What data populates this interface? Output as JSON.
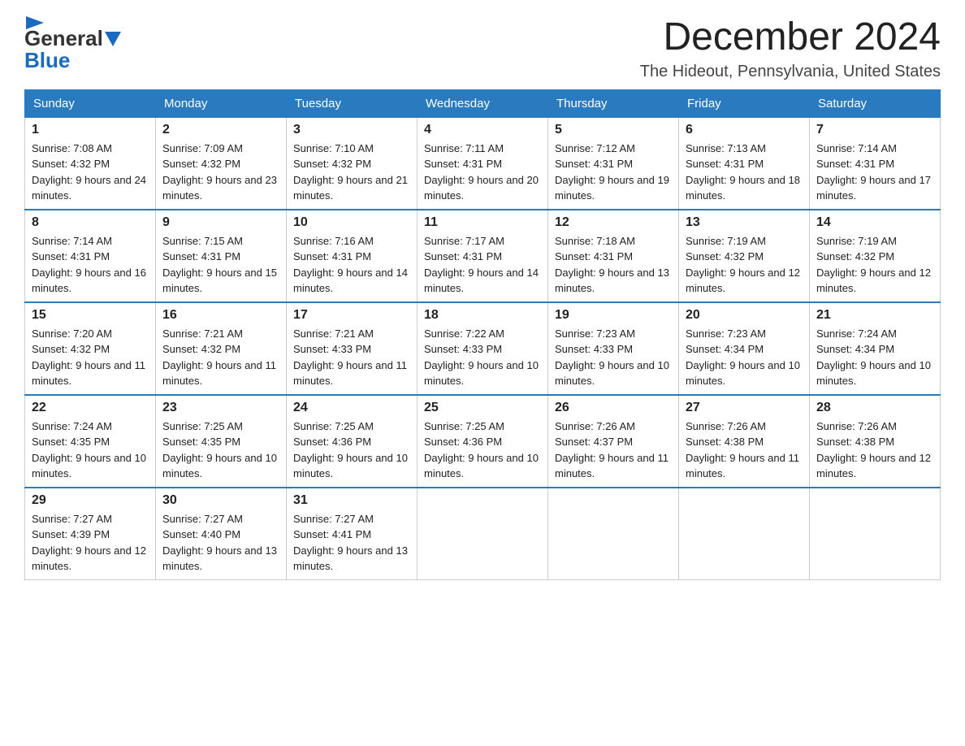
{
  "logo": {
    "general": "General",
    "blue": "Blue"
  },
  "title": {
    "month": "December 2024",
    "location": "The Hideout, Pennsylvania, United States"
  },
  "header": {
    "days": [
      "Sunday",
      "Monday",
      "Tuesday",
      "Wednesday",
      "Thursday",
      "Friday",
      "Saturday"
    ]
  },
  "weeks": [
    [
      {
        "date": "1",
        "sunrise": "7:08 AM",
        "sunset": "4:32 PM",
        "daylight": "9 hours and 24 minutes."
      },
      {
        "date": "2",
        "sunrise": "7:09 AM",
        "sunset": "4:32 PM",
        "daylight": "9 hours and 23 minutes."
      },
      {
        "date": "3",
        "sunrise": "7:10 AM",
        "sunset": "4:32 PM",
        "daylight": "9 hours and 21 minutes."
      },
      {
        "date": "4",
        "sunrise": "7:11 AM",
        "sunset": "4:31 PM",
        "daylight": "9 hours and 20 minutes."
      },
      {
        "date": "5",
        "sunrise": "7:12 AM",
        "sunset": "4:31 PM",
        "daylight": "9 hours and 19 minutes."
      },
      {
        "date": "6",
        "sunrise": "7:13 AM",
        "sunset": "4:31 PM",
        "daylight": "9 hours and 18 minutes."
      },
      {
        "date": "7",
        "sunrise": "7:14 AM",
        "sunset": "4:31 PM",
        "daylight": "9 hours and 17 minutes."
      }
    ],
    [
      {
        "date": "8",
        "sunrise": "7:14 AM",
        "sunset": "4:31 PM",
        "daylight": "9 hours and 16 minutes."
      },
      {
        "date": "9",
        "sunrise": "7:15 AM",
        "sunset": "4:31 PM",
        "daylight": "9 hours and 15 minutes."
      },
      {
        "date": "10",
        "sunrise": "7:16 AM",
        "sunset": "4:31 PM",
        "daylight": "9 hours and 14 minutes."
      },
      {
        "date": "11",
        "sunrise": "7:17 AM",
        "sunset": "4:31 PM",
        "daylight": "9 hours and 14 minutes."
      },
      {
        "date": "12",
        "sunrise": "7:18 AM",
        "sunset": "4:31 PM",
        "daylight": "9 hours and 13 minutes."
      },
      {
        "date": "13",
        "sunrise": "7:19 AM",
        "sunset": "4:32 PM",
        "daylight": "9 hours and 12 minutes."
      },
      {
        "date": "14",
        "sunrise": "7:19 AM",
        "sunset": "4:32 PM",
        "daylight": "9 hours and 12 minutes."
      }
    ],
    [
      {
        "date": "15",
        "sunrise": "7:20 AM",
        "sunset": "4:32 PM",
        "daylight": "9 hours and 11 minutes."
      },
      {
        "date": "16",
        "sunrise": "7:21 AM",
        "sunset": "4:32 PM",
        "daylight": "9 hours and 11 minutes."
      },
      {
        "date": "17",
        "sunrise": "7:21 AM",
        "sunset": "4:33 PM",
        "daylight": "9 hours and 11 minutes."
      },
      {
        "date": "18",
        "sunrise": "7:22 AM",
        "sunset": "4:33 PM",
        "daylight": "9 hours and 10 minutes."
      },
      {
        "date": "19",
        "sunrise": "7:23 AM",
        "sunset": "4:33 PM",
        "daylight": "9 hours and 10 minutes."
      },
      {
        "date": "20",
        "sunrise": "7:23 AM",
        "sunset": "4:34 PM",
        "daylight": "9 hours and 10 minutes."
      },
      {
        "date": "21",
        "sunrise": "7:24 AM",
        "sunset": "4:34 PM",
        "daylight": "9 hours and 10 minutes."
      }
    ],
    [
      {
        "date": "22",
        "sunrise": "7:24 AM",
        "sunset": "4:35 PM",
        "daylight": "9 hours and 10 minutes."
      },
      {
        "date": "23",
        "sunrise": "7:25 AM",
        "sunset": "4:35 PM",
        "daylight": "9 hours and 10 minutes."
      },
      {
        "date": "24",
        "sunrise": "7:25 AM",
        "sunset": "4:36 PM",
        "daylight": "9 hours and 10 minutes."
      },
      {
        "date": "25",
        "sunrise": "7:25 AM",
        "sunset": "4:36 PM",
        "daylight": "9 hours and 10 minutes."
      },
      {
        "date": "26",
        "sunrise": "7:26 AM",
        "sunset": "4:37 PM",
        "daylight": "9 hours and 11 minutes."
      },
      {
        "date": "27",
        "sunrise": "7:26 AM",
        "sunset": "4:38 PM",
        "daylight": "9 hours and 11 minutes."
      },
      {
        "date": "28",
        "sunrise": "7:26 AM",
        "sunset": "4:38 PM",
        "daylight": "9 hours and 12 minutes."
      }
    ],
    [
      {
        "date": "29",
        "sunrise": "7:27 AM",
        "sunset": "4:39 PM",
        "daylight": "9 hours and 12 minutes."
      },
      {
        "date": "30",
        "sunrise": "7:27 AM",
        "sunset": "4:40 PM",
        "daylight": "9 hours and 13 minutes."
      },
      {
        "date": "31",
        "sunrise": "7:27 AM",
        "sunset": "4:41 PM",
        "daylight": "9 hours and 13 minutes."
      },
      null,
      null,
      null,
      null
    ]
  ]
}
